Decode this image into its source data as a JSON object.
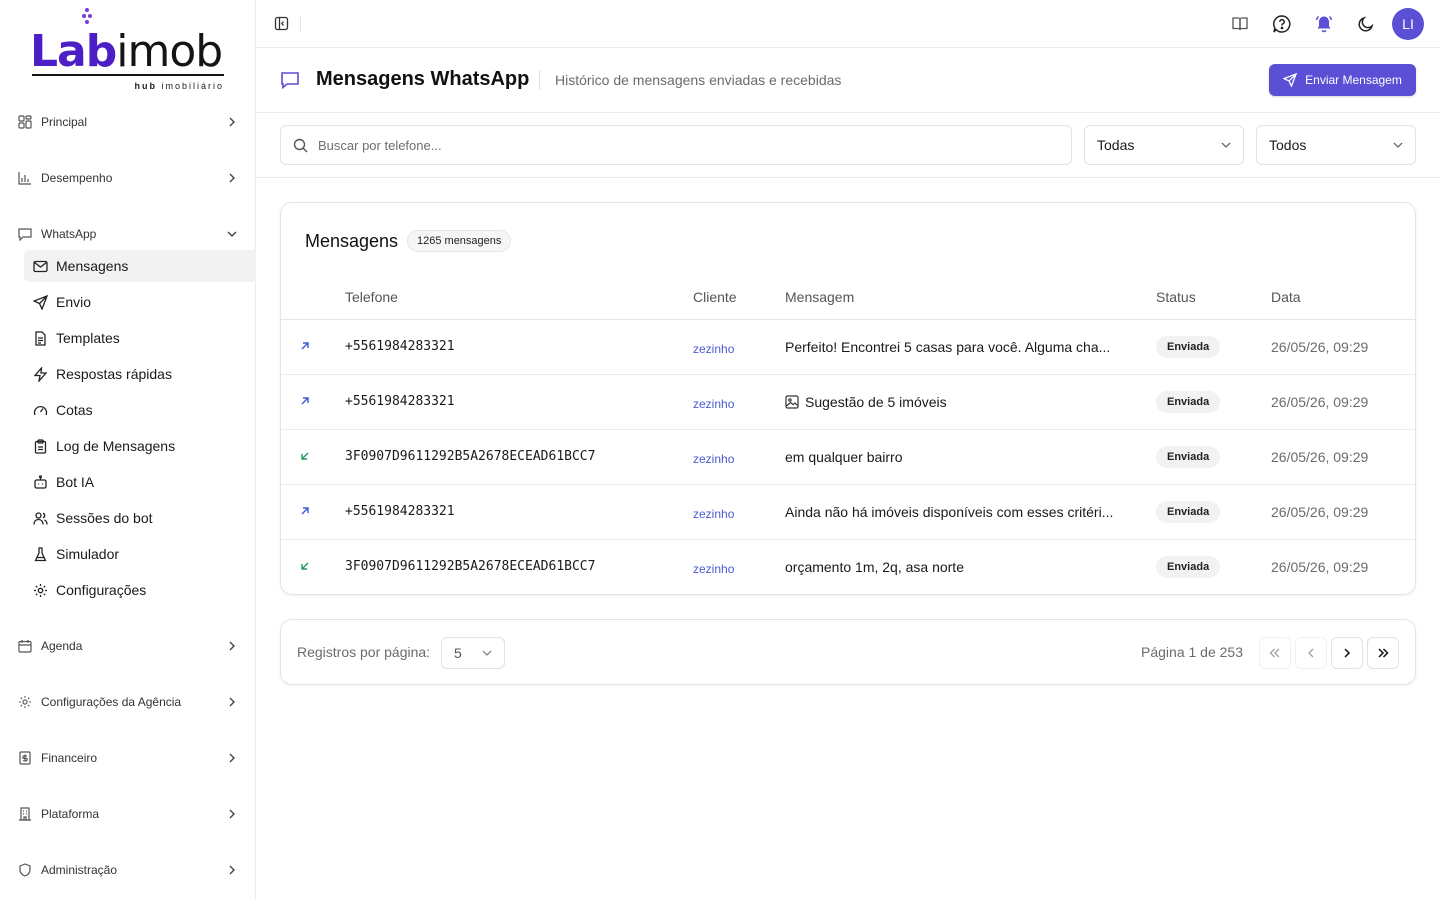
{
  "brand": {
    "name_part1": "Lab",
    "name_part2": "imob",
    "tagline_bold": "hub",
    "tagline_rest": "imobiliário",
    "color": "#4b1ec6"
  },
  "sidebar": {
    "groups": [
      {
        "label": "Principal",
        "icon": "grid-icon"
      },
      {
        "label": "Desempenho",
        "icon": "bar-chart-icon"
      },
      {
        "label": "WhatsApp",
        "icon": "message-square-icon"
      },
      {
        "label": "Agenda",
        "icon": "calendar-icon"
      },
      {
        "label": "Configurações da Agência",
        "icon": "gear-icon"
      },
      {
        "label": "Financeiro",
        "icon": "receipt-icon"
      },
      {
        "label": "Plataforma",
        "icon": "building-icon"
      },
      {
        "label": "Administração",
        "icon": "shield-icon"
      }
    ],
    "whatsapp_items": [
      {
        "label": "Mensagens",
        "icon": "mail-icon",
        "active": true
      },
      {
        "label": "Envio",
        "icon": "send-icon"
      },
      {
        "label": "Templates",
        "icon": "file-text-icon"
      },
      {
        "label": "Respostas rápidas",
        "icon": "zap-icon"
      },
      {
        "label": "Cotas",
        "icon": "gauge-icon"
      },
      {
        "label": "Log de Mensagens",
        "icon": "clipboard-icon"
      },
      {
        "label": "Bot IA",
        "icon": "bot-icon"
      },
      {
        "label": "Sessões do bot",
        "icon": "users-icon"
      },
      {
        "label": "Simulador",
        "icon": "flask-icon"
      },
      {
        "label": "Configurações",
        "icon": "gear-icon"
      }
    ]
  },
  "topbar": {
    "avatar_initials": "LI",
    "accent": "#5b4fd6"
  },
  "header": {
    "title": "Mensagens WhatsApp",
    "subtitle": "Histórico de mensagens enviadas e recebidas",
    "send_button": "Enviar Mensagem"
  },
  "filters": {
    "search_placeholder": "Buscar por telefone...",
    "select1_value": "Todas",
    "select2_value": "Todos"
  },
  "messages_card": {
    "title": "Mensagens",
    "count_badge": "1265 mensagens",
    "columns": [
      "Telefone",
      "Cliente",
      "Mensagem",
      "Status",
      "Data"
    ],
    "rows": [
      {
        "direction": "outgoing",
        "phone": "+5561984283321",
        "client": "zezinho",
        "message": "Perfeito! Encontrei 5 casas para você. Alguma cha...",
        "has_image": false,
        "status": "Enviada",
        "date": "26/05/26, 09:29"
      },
      {
        "direction": "outgoing",
        "phone": "+5561984283321",
        "client": "zezinho",
        "message": "Sugestão de 5 imóveis",
        "has_image": true,
        "status": "Enviada",
        "date": "26/05/26, 09:29"
      },
      {
        "direction": "incoming",
        "phone": "3F0907D9611292B5A2678ECEAD61BCC7",
        "client": "zezinho",
        "message": "em qualquer bairro",
        "has_image": false,
        "status": "Enviada",
        "date": "26/05/26, 09:29"
      },
      {
        "direction": "outgoing",
        "phone": "+5561984283321",
        "client": "zezinho",
        "message": "Ainda não há imóveis disponíveis com esses critéri...",
        "has_image": false,
        "status": "Enviada",
        "date": "26/05/26, 09:29"
      },
      {
        "direction": "incoming",
        "phone": "3F0907D9611292B5A2678ECEAD61BCC7",
        "client": "zezinho",
        "message": "orçamento 1m, 2q, asa norte",
        "has_image": false,
        "status": "Enviada",
        "date": "26/05/26, 09:29"
      }
    ]
  },
  "pagination": {
    "per_page_label": "Registros por página:",
    "per_page_value": "5",
    "page_info": "Página 1 de 253"
  }
}
